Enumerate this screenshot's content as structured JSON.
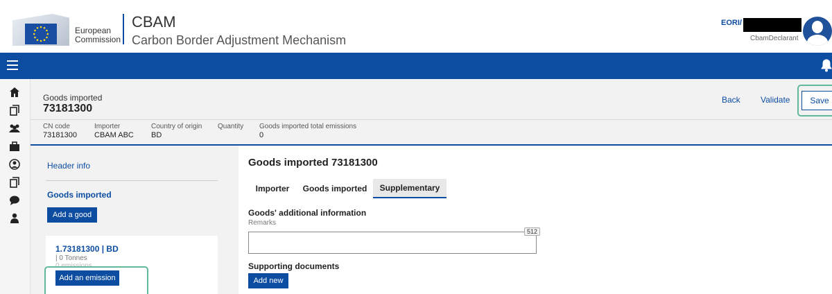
{
  "header": {
    "org_line1": "European",
    "org_line2": "Commission",
    "app_title": "CBAM",
    "app_subtitle": "Carbon Border Adjustment Mechanism",
    "eori_label": "EORI/",
    "user_role": "CbamDeclarant"
  },
  "icons": {
    "menu": "hamburger-icon",
    "notifications": "bell-icon",
    "rail": [
      "home-icon",
      "documents-icon",
      "users-icon",
      "briefcase-icon",
      "profile-icon",
      "documents-icon",
      "chat-icon",
      "person-icon"
    ]
  },
  "summary": {
    "label": "Goods imported",
    "code": "73181300",
    "columns": [
      {
        "label": "CN code",
        "value": "73181300"
      },
      {
        "label": "Importer",
        "value": "CBAM ABC"
      },
      {
        "label": "Country of origin",
        "value": "BD"
      },
      {
        "label": "Quantity",
        "value": ""
      },
      {
        "label": "Goods imported total emissions",
        "value": "0"
      }
    ],
    "actions": {
      "back": "Back",
      "validate": "Validate",
      "save": "Save"
    }
  },
  "left_panel": {
    "header_info_link": "Header info",
    "goods_title": "Goods imported",
    "add_good_button": "Add a good",
    "good_card": {
      "title": "1.73181300 | BD",
      "quantity": "| 0 Tonnes",
      "emissions": "0 emissions",
      "add_emission_button": "Add an emission"
    }
  },
  "main": {
    "title": "Goods imported 73181300",
    "tabs": [
      {
        "label": "Importer",
        "active": false
      },
      {
        "label": "Goods imported",
        "active": false
      },
      {
        "label": "Supplementary",
        "active": true
      }
    ],
    "additional_info_title": "Goods' additional information",
    "remarks_label": "Remarks",
    "remarks_value": "",
    "remarks_counter": "512",
    "supporting_docs_title": "Supporting documents",
    "add_new_button": "Add new"
  },
  "colors": {
    "brand_blue": "#0c4da2",
    "highlight_green": "#5fb99a",
    "panel_gray": "#f2f2f2"
  }
}
